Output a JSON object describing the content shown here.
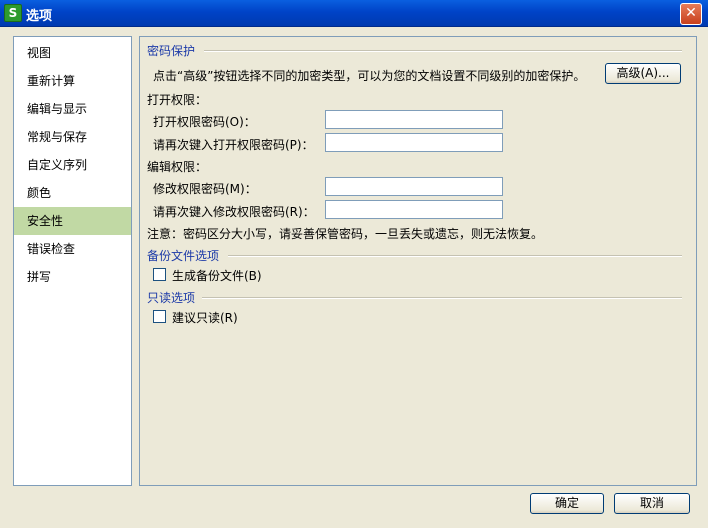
{
  "window": {
    "title": "选项",
    "app_icon_letter": "S",
    "close_glyph": "✕"
  },
  "sidebar": {
    "items": [
      {
        "label": "视图"
      },
      {
        "label": "重新计算"
      },
      {
        "label": "编辑与显示"
      },
      {
        "label": "常规与保存"
      },
      {
        "label": "自定义序列"
      },
      {
        "label": "颜色"
      },
      {
        "label": "安全性"
      },
      {
        "label": "错误检查"
      },
      {
        "label": "拼写"
      }
    ],
    "selected": "安全性"
  },
  "password_protection": {
    "heading": "密码保护",
    "hint": "点击“高级”按钮选择不同的加密类型，可以为您的文档设置不同级别的加密保护。",
    "advanced_button": "高级(A)...",
    "open_group": "打开权限：",
    "open_password_label": "打开权限密码(O)：",
    "open_password_confirm_label": "请再次键入打开权限密码(P)：",
    "modify_group": "编辑权限：",
    "modify_password_label": "修改权限密码(M)：",
    "modify_password_confirm_label": "请再次键入修改权限密码(R)：",
    "note": "注意：密码区分大小写，请妥善保管密码，一旦丢失或遗忘，则无法恢复。"
  },
  "backup": {
    "heading": "备份文件选项",
    "create_backup_label": "生成备份文件(B)",
    "checked": false
  },
  "readonly": {
    "heading": "只读选项",
    "suggest_readonly_label": "建议只读(R)",
    "checked": false
  },
  "footer": {
    "ok_button": "确定",
    "cancel_button": "取消"
  },
  "colors": {
    "title_bar": "#0054e3",
    "selected_item": "#c1d9a4",
    "section_heading": "#1c3aa8",
    "dialog_bg": "#ece9d8"
  }
}
